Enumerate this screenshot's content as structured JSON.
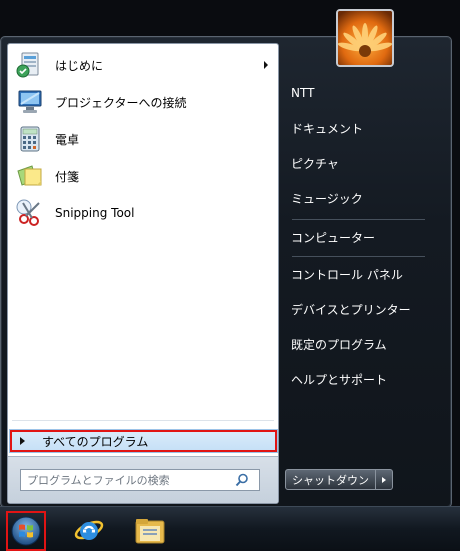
{
  "start_menu": {
    "programs": [
      {
        "label": "はじめに",
        "icon": "getting-started-icon",
        "has_submenu": true
      },
      {
        "label": "プロジェクターへの接続",
        "icon": "projector-icon",
        "has_submenu": false
      },
      {
        "label": "電卓",
        "icon": "calculator-icon",
        "has_submenu": false
      },
      {
        "label": "付箋",
        "icon": "sticky-notes-icon",
        "has_submenu": false
      },
      {
        "label": "Snipping Tool",
        "icon": "scissors-icon",
        "has_submenu": false
      }
    ],
    "all_programs_label": "すべてのプログラム",
    "search": {
      "placeholder": "プログラムとファイルの検索",
      "value": ""
    },
    "right_items": [
      "NTT",
      "ドキュメント",
      "ピクチャ",
      "ミュージック",
      "コンピューター",
      "コントロール パネル",
      "デバイスとプリンター",
      "既定のプログラム",
      "ヘルプとサポート"
    ],
    "shutdown_label": "シャットダウン",
    "user_picture": "flower-user-picture"
  },
  "taskbar": {
    "items": [
      "start-orb",
      "internet-explorer-icon",
      "windows-explorer-icon"
    ]
  },
  "colors": {
    "highlight_border": "#e11414",
    "all_programs_bg": "#c4dff6",
    "menu_dark": "#141a22"
  }
}
